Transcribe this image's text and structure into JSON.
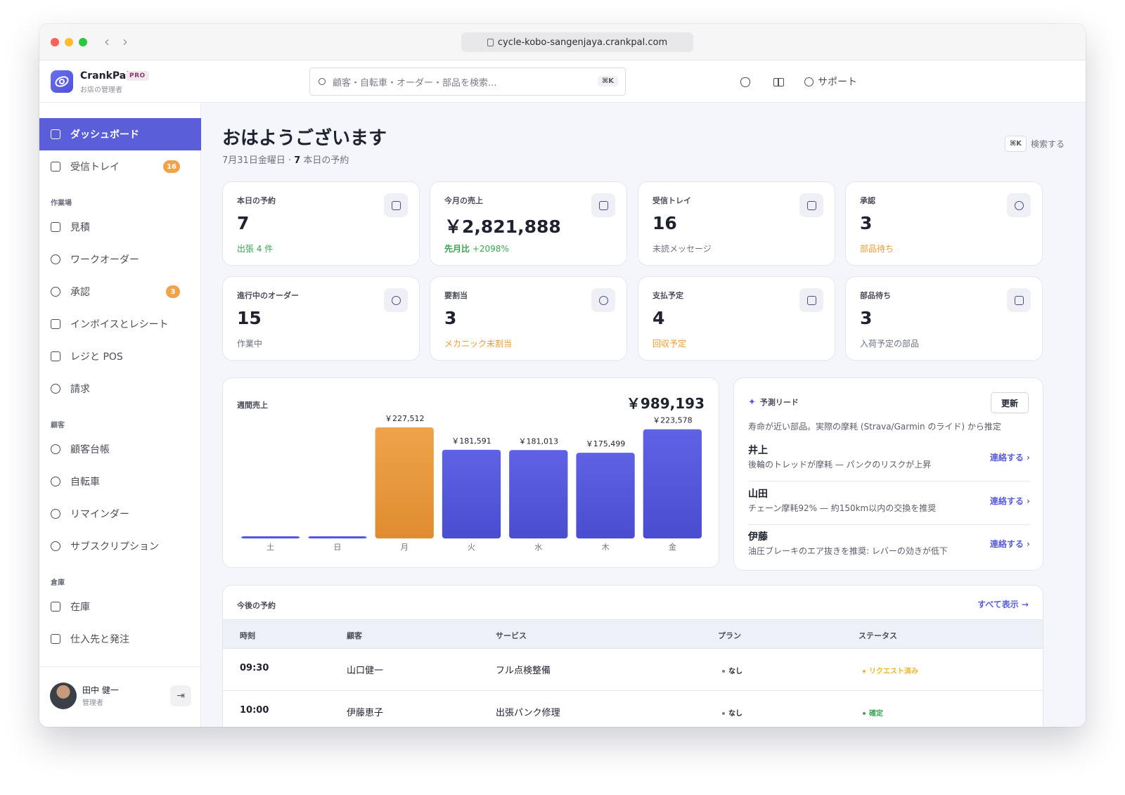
{
  "browser": {
    "url": "cycle-kobo-sangenjaya.crankpal.com"
  },
  "brand": {
    "name": "CrankPal",
    "badge": "PRO",
    "subtitle": "お店の管理者"
  },
  "search": {
    "placeholder": "顧客・自転車・オーダー・部品を検索...",
    "shortcut": "⌘K"
  },
  "topnav": {
    "support_label": "サポート"
  },
  "sidebar": {
    "items": [
      {
        "label": "ダッシュボード"
      },
      {
        "label": "受信トレイ",
        "badge": "16"
      }
    ],
    "section_workshop": "作業場",
    "workshop": [
      {
        "label": "見積"
      },
      {
        "label": "ワークオーダー"
      },
      {
        "label": "承認",
        "badge": "3"
      },
      {
        "label": "インボイスとレシート"
      },
      {
        "label": "レジと POS"
      },
      {
        "label": "請求"
      }
    ],
    "section_customers": "顧客",
    "customers": [
      {
        "label": "顧客台帳"
      },
      {
        "label": "自転車"
      },
      {
        "label": "リマインダー"
      },
      {
        "label": "サブスクリプション"
      }
    ],
    "section_warehouse": "倉庫",
    "warehouse": [
      {
        "label": "在庫"
      },
      {
        "label": "仕入先と発注"
      }
    ],
    "user": {
      "name": "田中 健一",
      "role": "管理者"
    }
  },
  "main": {
    "greeting": "おはようございます",
    "date": "7月31日金曜日 · ",
    "today_count": "7",
    "today_suffix": " 本日の予約",
    "search_hint_kbd": "⌘K",
    "search_hint_label": "検索する"
  },
  "stats": [
    {
      "label": "本日の予約",
      "value": "7",
      "note": "出張 4 件",
      "icon": "calendar-icon"
    },
    {
      "label": "今月の売上",
      "value": "￥2,821,888",
      "note_prefix": "先月比",
      "note": "+2098%",
      "icon": "cash-icon"
    },
    {
      "label": "受信トレイ",
      "value": "16",
      "note": "未読メッセージ",
      "icon": "inbox-icon"
    },
    {
      "label": "承認",
      "value": "3",
      "note": "部品待ち",
      "icon": "check-circle-icon"
    },
    {
      "label": "進行中のオーダー",
      "value": "15",
      "note": "作業中",
      "icon": "wrench-icon"
    },
    {
      "label": "要割当",
      "value": "3",
      "note": "メカニック未割当",
      "icon": "users-icon"
    },
    {
      "label": "支払予定",
      "value": "4",
      "note": "回収予定",
      "icon": "document-icon"
    },
    {
      "label": "部品待ち",
      "value": "3",
      "note": "入荷予定の部品",
      "icon": "box-icon"
    }
  ],
  "weekly": {
    "title": "週間売上",
    "total": "￥989,193"
  },
  "chart_data": {
    "type": "bar",
    "title": "週間売上",
    "categories": [
      "土",
      "日",
      "月",
      "火",
      "水",
      "木",
      "金"
    ],
    "values": [
      0,
      0,
      227512,
      181591,
      181013,
      175499,
      223578
    ],
    "labels": [
      "",
      "",
      "￥227,512",
      "￥181,591",
      "￥181,013",
      "￥175,499",
      "￥223,578"
    ],
    "highlight_index": 2,
    "colors": {
      "default": "#5457dc",
      "highlight": "#ee9d3f"
    }
  },
  "leads": {
    "title": "予測リード",
    "refresh_label": "更新",
    "description": "寿命が近い部品。実際の摩耗 (Strava/Garmin のライド) から推定",
    "items": [
      {
        "name": "井上",
        "text": "後輪のトレッドが摩耗 — パンクのリスクが上昇",
        "action": "連絡する ›"
      },
      {
        "name": "山田",
        "text": "チェーン摩耗92% — 約150km以内の交換を推奨",
        "action": "連絡する ›"
      },
      {
        "name": "伊藤",
        "text": "油圧ブレーキのエア抜きを推奨: レバーの効きが低下",
        "action": "連絡する ›"
      }
    ]
  },
  "upcoming": {
    "title": "今後の予約",
    "view_all": "すべて表示 →",
    "headers": [
      "時刻",
      "顧客",
      "サービス",
      "プラン",
      "ステータス"
    ],
    "rows": [
      {
        "time": "09:30",
        "customer": "山口健一",
        "service": "フル点検整備",
        "plan": "なし",
        "status": "リクエスト済み",
        "status_color": "#f0b429"
      },
      {
        "time": "10:00",
        "customer": "伊藤恵子",
        "service": "出張パンク修理",
        "plan": "なし",
        "status": "確定",
        "status_color": "#3aa555"
      }
    ]
  }
}
